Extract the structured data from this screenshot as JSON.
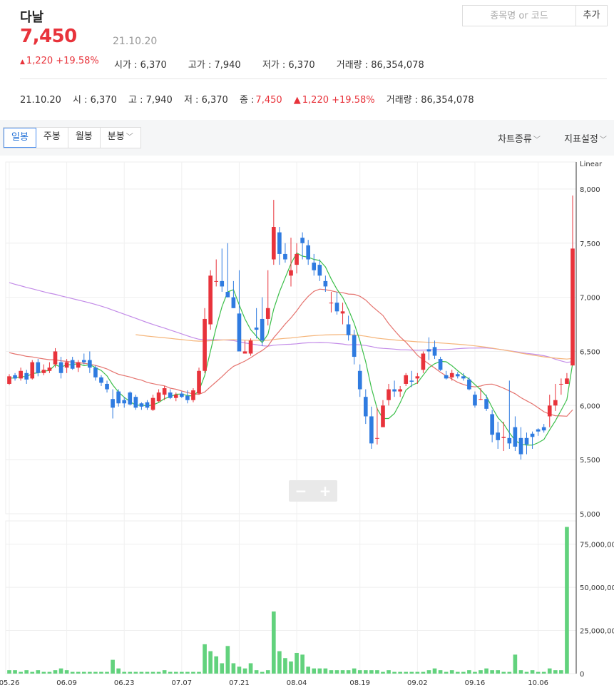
{
  "stock": {
    "name": "다날",
    "price": "7,450",
    "date": "21.10.20",
    "change_arrow": "▲",
    "change": "1,220 +19.58%",
    "open": "시가 : 6,370",
    "high": "고가 : 7,940",
    "low": "저가 : 6,370",
    "volume": "거래량 : 86,354,078"
  },
  "search": {
    "placeholder": "종목명 or 코드",
    "add_label": "추가"
  },
  "info_row": {
    "date": "21.10.20",
    "open": "시 : 6,370",
    "high": "고 : 7,940",
    "low": "저 : 6,370",
    "close_label": "종 :",
    "close": "7,450",
    "change_arrow": "▲",
    "change": "1,220 +19.58%",
    "volume": "거래량 : 86,354,078"
  },
  "tabs": [
    "일봉",
    "주봉",
    "월봉",
    "분봉"
  ],
  "toolbar": {
    "chart_type": "차트종류",
    "indicator": "지표설정"
  },
  "zoom": {
    "minus": "−",
    "plus": "+"
  },
  "colors": {
    "up": "#e8333b",
    "down": "#2f7be0",
    "volume": "#62d27d",
    "ma5": "#3cbf4a",
    "ma20": "#e5736e",
    "ma60": "#c38ce8",
    "ma120": "#f5b57a"
  },
  "chart_data": {
    "type": "candlestick",
    "scale": "Linear",
    "ylim": [
      5000,
      8250
    ],
    "y_ticks": [
      "8,000",
      "7,500",
      "7,000",
      "6,500",
      "6,000",
      "5,500",
      "5,000"
    ],
    "volume_ticks": [
      "75,000,000",
      "50,000,000",
      "25,000,000",
      "0"
    ],
    "x_ticks": [
      "05.26",
      "06.09",
      "06.23",
      "07.07",
      "07.21",
      "08.04",
      "08.19",
      "09.02",
      "09.16",
      "10.06"
    ],
    "candles": [
      [
        6200,
        6290,
        6190,
        6270
      ],
      [
        6280,
        6300,
        6230,
        6250
      ],
      [
        6250,
        6350,
        6230,
        6320
      ],
      [
        6300,
        6330,
        6200,
        6240
      ],
      [
        6250,
        6420,
        6240,
        6400
      ],
      [
        6400,
        6430,
        6270,
        6300
      ],
      [
        6300,
        6380,
        6280,
        6330
      ],
      [
        6320,
        6400,
        6300,
        6350
      ],
      [
        6380,
        6530,
        6350,
        6500
      ],
      [
        6400,
        6450,
        6250,
        6300
      ],
      [
        6350,
        6430,
        6300,
        6400
      ],
      [
        6420,
        6450,
        6330,
        6340
      ],
      [
        6350,
        6420,
        6310,
        6400
      ],
      [
        6420,
        6480,
        6380,
        6400
      ],
      [
        6420,
        6500,
        6300,
        6350
      ],
      [
        6350,
        6370,
        6230,
        6260
      ],
      [
        6260,
        6280,
        6180,
        6210
      ],
      [
        6200,
        6230,
        6120,
        6150
      ],
      [
        6060,
        6150,
        5880,
        5980
      ],
      [
        6130,
        6150,
        5990,
        6020
      ],
      [
        6050,
        6080,
        5980,
        6020
      ],
      [
        6120,
        6130,
        6000,
        6010
      ],
      [
        6080,
        6100,
        5960,
        5980
      ],
      [
        6020,
        6030,
        5960,
        5990
      ],
      [
        6030,
        6050,
        5960,
        5980
      ],
      [
        5960,
        6100,
        5950,
        6070
      ],
      [
        6040,
        6150,
        6030,
        6120
      ],
      [
        6100,
        6180,
        6050,
        6160
      ],
      [
        6120,
        6150,
        6060,
        6070
      ],
      [
        6070,
        6120,
        6040,
        6100
      ],
      [
        6110,
        6130,
        6070,
        6080
      ],
      [
        6090,
        6140,
        6020,
        6050
      ],
      [
        6050,
        6160,
        6030,
        6140
      ],
      [
        6110,
        6350,
        6100,
        6320
      ],
      [
        6320,
        6900,
        6300,
        6800
      ],
      [
        6750,
        7250,
        6700,
        7200
      ],
      [
        7150,
        7350,
        7100,
        7150
      ],
      [
        7150,
        7450,
        7050,
        7100
      ],
      [
        7050,
        7500,
        7000,
        7000
      ],
      [
        7000,
        7150,
        6900,
        6900
      ],
      [
        6850,
        7250,
        6800,
        6500
      ],
      [
        6480,
        6600,
        6480,
        6500
      ],
      [
        6480,
        6620,
        6460,
        6600
      ],
      [
        6720,
        6900,
        6620,
        6700
      ],
      [
        6800,
        7000,
        6550,
        6600
      ],
      [
        6800,
        7250,
        6740,
        6900
      ],
      [
        7350,
        7900,
        7300,
        7650
      ],
      [
        7600,
        7650,
        7300,
        7400
      ],
      [
        7400,
        7500,
        7320,
        7350
      ],
      [
        7200,
        7550,
        7100,
        7250
      ],
      [
        7300,
        7500,
        7220,
        7400
      ],
      [
        7550,
        7600,
        7350,
        7500
      ],
      [
        7480,
        7530,
        7300,
        7350
      ],
      [
        7320,
        7400,
        7200,
        7250
      ],
      [
        7300,
        7350,
        7150,
        7200
      ],
      [
        7150,
        7200,
        7050,
        7100
      ],
      [
        6950,
        7050,
        6860,
        6950
      ],
      [
        6950,
        7050,
        6840,
        6870
      ],
      [
        6850,
        6950,
        6750,
        6870
      ],
      [
        6750,
        6830,
        6600,
        6650
      ],
      [
        6650,
        6700,
        6380,
        6450
      ],
      [
        6320,
        6380,
        6080,
        6150
      ],
      [
        6080,
        6150,
        5830,
        5900
      ],
      [
        5900,
        5990,
        5600,
        5650
      ],
      [
        5700,
        5980,
        5640,
        5700
      ],
      [
        5800,
        6050,
        5800,
        6000
      ],
      [
        6050,
        6200,
        6000,
        6150
      ],
      [
        6150,
        6230,
        6080,
        6130
      ],
      [
        6130,
        6180,
        6080,
        6150
      ],
      [
        6200,
        6300,
        6180,
        6280
      ],
      [
        6230,
        6320,
        6170,
        6220
      ],
      [
        6250,
        6300,
        6200,
        6270
      ],
      [
        6330,
        6500,
        6300,
        6480
      ],
      [
        6520,
        6630,
        6420,
        6500
      ],
      [
        6540,
        6600,
        6430,
        6460
      ],
      [
        6430,
        6450,
        6320,
        6330
      ],
      [
        6280,
        6320,
        6240,
        6250
      ],
      [
        6260,
        6330,
        6230,
        6300
      ],
      [
        6290,
        6310,
        6250,
        6270
      ],
      [
        6270,
        6300,
        6230,
        6250
      ],
      [
        6240,
        6260,
        6140,
        6150
      ],
      [
        6100,
        6130,
        5980,
        6000
      ],
      [
        6060,
        6160,
        6050,
        6060
      ],
      [
        6060,
        6100,
        5950,
        5970
      ],
      [
        5920,
        5960,
        5660,
        5730
      ],
      [
        5750,
        5850,
        5600,
        5680
      ],
      [
        5700,
        5850,
        5580,
        5710
      ],
      [
        5700,
        6230,
        5600,
        5650
      ],
      [
        5800,
        5900,
        5580,
        5620
      ],
      [
        5700,
        5800,
        5500,
        5550
      ],
      [
        5700,
        5750,
        5550,
        5640
      ],
      [
        5740,
        5760,
        5600,
        5710
      ],
      [
        5780,
        5790,
        5720,
        5760
      ],
      [
        5800,
        5830,
        5750,
        5770
      ],
      [
        5900,
        6100,
        5800,
        6000
      ],
      [
        6000,
        6200,
        5950,
        6050
      ],
      [
        6200,
        6250,
        6100,
        6200
      ],
      [
        6200,
        6300,
        6200,
        6250
      ],
      [
        6370,
        7940,
        6370,
        7450
      ]
    ],
    "volumes_millions": [
      2,
      2,
      1,
      2,
      1,
      2,
      1,
      1,
      2,
      3,
      2,
      1,
      1,
      1,
      1,
      1,
      1,
      1,
      8,
      3,
      1,
      1,
      1,
      1,
      1,
      1,
      1,
      2,
      1,
      1,
      1,
      1,
      1,
      1,
      17,
      13,
      10,
      6,
      16,
      6,
      4,
      3,
      6,
      2,
      1,
      2,
      36,
      13,
      9,
      7,
      12,
      11,
      4,
      3,
      3,
      3,
      2,
      2,
      2,
      2,
      3,
      2,
      2,
      2,
      2,
      1,
      2,
      1,
      1,
      1,
      1,
      1,
      1,
      2,
      3,
      2,
      1,
      2,
      1,
      1,
      2,
      1,
      2,
      3,
      2,
      2,
      1,
      1,
      11,
      2,
      1,
      2,
      1,
      1,
      3,
      2,
      2,
      85
    ]
  }
}
